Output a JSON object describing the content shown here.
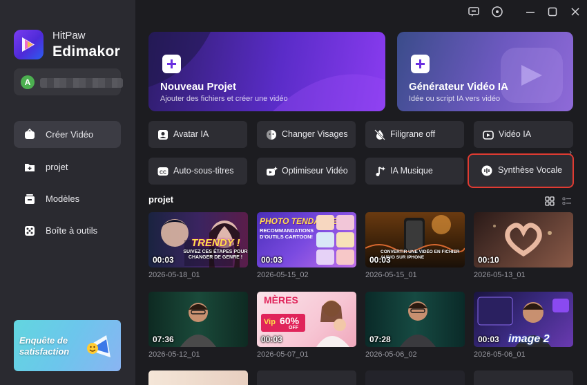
{
  "app": {
    "brand_line1": "HitPaw",
    "brand_line2": "Edimakor",
    "avatar_letter": "A"
  },
  "sidebar": {
    "items": [
      {
        "label": "Créer Vidéo",
        "icon": "create-video-icon",
        "active": true
      },
      {
        "label": "projet",
        "icon": "folder-plus-icon",
        "active": false
      },
      {
        "label": "Modèles",
        "icon": "templates-icon",
        "active": false
      },
      {
        "label": "Boîte à outils",
        "icon": "toolbox-icon",
        "active": false
      }
    ],
    "survey_text": "Enquête de satisfaction"
  },
  "cards": {
    "new_project": {
      "title": "Nouveau Projet",
      "subtitle": "Ajouter des fichiers et créer une vidéo"
    },
    "ai_video": {
      "title": "Générateur Vidéo IA",
      "subtitle": "Idée ou script IA vers vidéo"
    }
  },
  "tools": [
    {
      "label": "Avatar IA",
      "icon": "avatar-icon"
    },
    {
      "label": "Changer Visages",
      "icon": "face-swap-icon"
    },
    {
      "label": "Filigrane off",
      "icon": "watermark-off-icon"
    },
    {
      "label": "Vidéo IA",
      "icon": "ai-video-icon"
    },
    {
      "label": "Auto-sous-titres",
      "icon": "cc-icon"
    },
    {
      "label": "Optimiseur Vidéo",
      "icon": "video-enhancer-icon"
    },
    {
      "label": "IA Musique",
      "icon": "music-icon"
    },
    {
      "label": "Synthèse Vocale",
      "icon": "tts-icon"
    }
  ],
  "projects_title": "projet",
  "projects": [
    {
      "duration": "00:03",
      "date": "2026-05-18_01"
    },
    {
      "duration": "00:03",
      "date": "2026-05-15_02"
    },
    {
      "duration": "00:03",
      "date": "2026-05-15_01"
    },
    {
      "duration": "00:10",
      "date": "2026-05-13_01"
    },
    {
      "duration": "07:36",
      "date": "2026-05-12_01"
    },
    {
      "duration": "00:03",
      "date": "2026-05-07_01"
    },
    {
      "duration": "07:28",
      "date": "2026-05-06_02"
    },
    {
      "duration": "00:03",
      "date": "2026-05-06_01"
    }
  ],
  "thumb_text": {
    "t1": "TRENDY !",
    "t1b": "SUIVEZ CES ÉTAPES POUR CHANGER DE GENRE !",
    "t2": "PHOTO TENDANCES",
    "t2b": "RECOMMANDATIONS D'OUTILS CARTOON!",
    "t3": "CONVERTIR UNE VIDÉO EN FICHIER AUDIO SUR IPHONE",
    "t6a": "MÈRES",
    "t6b": "60%",
    "t6c": "OFF",
    "t6d": "Vip",
    "t8": "image 2"
  },
  "colors": {
    "accent_purple": "#7a2fe0",
    "highlight_red": "#e03b32",
    "bg": "#1c1c20"
  }
}
